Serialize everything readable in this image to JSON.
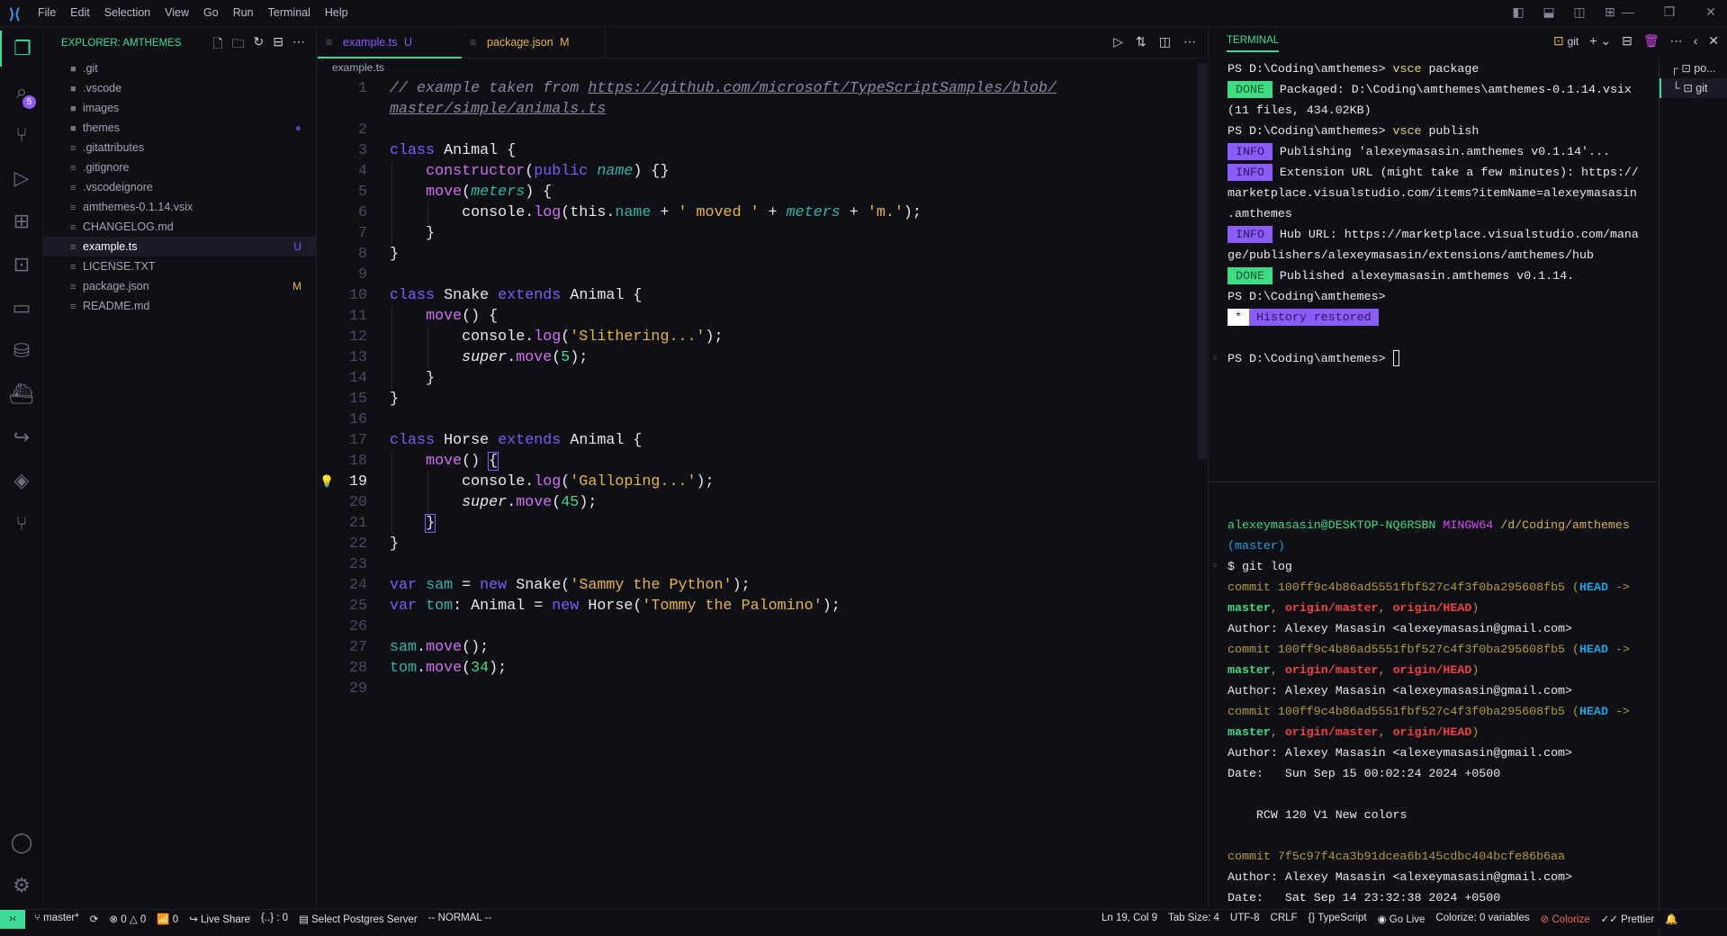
{
  "titlebar": {
    "menu": [
      "File",
      "Edit",
      "Selection",
      "View",
      "Go",
      "Run",
      "Terminal",
      "Help"
    ],
    "window_controls": [
      "toggle-primary-sidebar",
      "toggle-panel",
      "toggle-secondary-sidebar",
      "customize-layout",
      "minimize",
      "restore",
      "close"
    ]
  },
  "activity_bar": {
    "items": [
      "explorer",
      "search",
      "source-control",
      "run-debug",
      "extensions",
      "remote-explorer",
      "project-manager",
      "database",
      "docker",
      "live-share",
      "gitlens",
      "git-graph"
    ],
    "search_badge": "5",
    "bottom": [
      "accounts",
      "manage"
    ]
  },
  "sidebar": {
    "title": "EXPLORER: AMTHEMES",
    "items": [
      {
        "name": ".git",
        "type": "folder",
        "status": ""
      },
      {
        "name": ".vscode",
        "type": "folder",
        "status": ""
      },
      {
        "name": "images",
        "type": "folder",
        "status": ""
      },
      {
        "name": "themes",
        "type": "folder",
        "status": "●"
      },
      {
        "name": ".gitattributes",
        "type": "file",
        "status": ""
      },
      {
        "name": ".gitignore",
        "type": "file",
        "status": ""
      },
      {
        "name": ".vscodeignore",
        "type": "file",
        "status": ""
      },
      {
        "name": "amthemes-0.1.14.vsix",
        "type": "file",
        "status": ""
      },
      {
        "name": "CHANGELOG.md",
        "type": "file",
        "status": ""
      },
      {
        "name": "example.ts",
        "type": "file",
        "status": "U",
        "selected": true
      },
      {
        "name": "LICENSE.TXT",
        "type": "file",
        "status": ""
      },
      {
        "name": "package.json",
        "type": "file",
        "status": "M"
      },
      {
        "name": "README.md",
        "type": "file",
        "status": ""
      }
    ]
  },
  "editor": {
    "tabs": [
      {
        "label": "example.ts",
        "status": "U",
        "active": true,
        "color": "#8b5cf6"
      },
      {
        "label": "package.json",
        "status": "M",
        "active": false,
        "color": "#e6b64a"
      }
    ],
    "breadcrumb": "example.ts",
    "current_line": 19,
    "lines": [
      {
        "n": "1",
        "t": [
          [
            "// example taken from ",
            "com"
          ],
          [
            "https://github.com/microsoft/TypeScriptSamples/blob/",
            "url"
          ]
        ]
      },
      {
        "n": "",
        "t": [
          [
            "master/simple/animals.ts",
            "url"
          ]
        ]
      },
      {
        "n": "2",
        "t": []
      },
      {
        "n": "3",
        "t": [
          [
            "class ",
            "kw"
          ],
          [
            "Animal {",
            "txt"
          ]
        ]
      },
      {
        "n": "4",
        "t": [
          [
            "    ",
            "txt"
          ],
          [
            "constructor",
            "fn"
          ],
          [
            "(",
            "txt"
          ],
          [
            "public ",
            "kw"
          ],
          [
            "name",
            "par"
          ],
          [
            ") {}",
            "txt"
          ]
        ]
      },
      {
        "n": "5",
        "t": [
          [
            "    ",
            "txt"
          ],
          [
            "move",
            "fn"
          ],
          [
            "(",
            "txt"
          ],
          [
            "meters",
            "par"
          ],
          [
            ") {",
            "txt"
          ]
        ]
      },
      {
        "n": "6",
        "t": [
          [
            "        console.",
            "txt"
          ],
          [
            "log",
            "fn"
          ],
          [
            "(this.",
            "txt"
          ],
          [
            "name",
            "prop"
          ],
          [
            " + ",
            "txt"
          ],
          [
            "' moved '",
            "str"
          ],
          [
            " + ",
            "txt"
          ],
          [
            "meters",
            "par"
          ],
          [
            " + ",
            "txt"
          ],
          [
            "'m.'",
            "str"
          ],
          [
            ");",
            "txt"
          ]
        ]
      },
      {
        "n": "7",
        "t": [
          [
            "    }",
            "txt"
          ]
        ]
      },
      {
        "n": "8",
        "t": [
          [
            "}",
            "txt"
          ]
        ]
      },
      {
        "n": "9",
        "t": []
      },
      {
        "n": "10",
        "t": [
          [
            "class ",
            "kw"
          ],
          [
            "Snake ",
            "txt"
          ],
          [
            "extends ",
            "kw"
          ],
          [
            "Animal {",
            "txt"
          ]
        ]
      },
      {
        "n": "11",
        "t": [
          [
            "    ",
            "txt"
          ],
          [
            "move",
            "fn"
          ],
          [
            "() {",
            "txt"
          ]
        ]
      },
      {
        "n": "12",
        "t": [
          [
            "        console.",
            "txt"
          ],
          [
            "log",
            "fn"
          ],
          [
            "(",
            "txt"
          ],
          [
            "'Slithering...'",
            "str"
          ],
          [
            ");",
            "txt"
          ]
        ]
      },
      {
        "n": "13",
        "t": [
          [
            "        ",
            "txt"
          ],
          [
            "super",
            "it"
          ],
          [
            ".",
            "txt"
          ],
          [
            "move",
            "fn"
          ],
          [
            "(",
            "txt"
          ],
          [
            "5",
            "num"
          ],
          [
            ");",
            "txt"
          ]
        ]
      },
      {
        "n": "14",
        "t": [
          [
            "    }",
            "txt"
          ]
        ]
      },
      {
        "n": "15",
        "t": [
          [
            "}",
            "txt"
          ]
        ]
      },
      {
        "n": "16",
        "t": []
      },
      {
        "n": "17",
        "t": [
          [
            "class ",
            "kw"
          ],
          [
            "Horse ",
            "txt"
          ],
          [
            "extends ",
            "kw"
          ],
          [
            "Animal {",
            "txt"
          ]
        ]
      },
      {
        "n": "18",
        "t": [
          [
            "    ",
            "txt"
          ],
          [
            "move",
            "fn"
          ],
          [
            "() ",
            "txt"
          ],
          [
            "{",
            "bracket"
          ]
        ]
      },
      {
        "n": "19",
        "t": [
          [
            "        console.",
            "txt"
          ],
          [
            "log",
            "fn"
          ],
          [
            "(",
            "txt"
          ],
          [
            "'Galloping...'",
            "str"
          ],
          [
            ");",
            "txt"
          ]
        ]
      },
      {
        "n": "20",
        "t": [
          [
            "        ",
            "txt"
          ],
          [
            "super",
            "it"
          ],
          [
            ".",
            "txt"
          ],
          [
            "move",
            "fn"
          ],
          [
            "(",
            "txt"
          ],
          [
            "45",
            "num"
          ],
          [
            ");",
            "txt"
          ]
        ]
      },
      {
        "n": "21",
        "t": [
          [
            "    ",
            "txt"
          ],
          [
            "}",
            "bracket"
          ]
        ]
      },
      {
        "n": "22",
        "t": [
          [
            "}",
            "txt"
          ]
        ]
      },
      {
        "n": "23",
        "t": []
      },
      {
        "n": "24",
        "t": [
          [
            "var ",
            "kw"
          ],
          [
            "sam",
            "var"
          ],
          [
            " = ",
            "txt"
          ],
          [
            "new ",
            "kw"
          ],
          [
            "Snake(",
            "txt"
          ],
          [
            "'Sammy the Python'",
            "str"
          ],
          [
            ");",
            "txt"
          ]
        ]
      },
      {
        "n": "25",
        "t": [
          [
            "var ",
            "kw"
          ],
          [
            "tom",
            "var"
          ],
          [
            ": Animal = ",
            "txt"
          ],
          [
            "new ",
            "kw"
          ],
          [
            "Horse(",
            "txt"
          ],
          [
            "'Tommy the Palomino'",
            "str"
          ],
          [
            ");",
            "txt"
          ]
        ]
      },
      {
        "n": "26",
        "t": []
      },
      {
        "n": "27",
        "t": [
          [
            "sam",
            "var"
          ],
          [
            ".",
            "txt"
          ],
          [
            "move",
            "fn"
          ],
          [
            "();",
            "txt"
          ]
        ]
      },
      {
        "n": "28",
        "t": [
          [
            "tom",
            "var"
          ],
          [
            ".",
            "txt"
          ],
          [
            "move",
            "fn"
          ],
          [
            "(",
            "txt"
          ],
          [
            "34",
            "num"
          ],
          [
            ");",
            "txt"
          ]
        ]
      },
      {
        "n": "29",
        "t": []
      }
    ]
  },
  "terminal": {
    "tab": "TERMINAL",
    "active_shell": "git",
    "list": [
      {
        "label": "po..."
      },
      {
        "label": "git",
        "selected": true
      }
    ],
    "pane1": [
      [
        [
          "PS D:\\Coding\\amthemes> ",
          ""
        ],
        [
          "vsce ",
          "yel"
        ],
        [
          "package",
          ""
        ]
      ],
      [
        [
          "DONE",
          "done"
        ],
        [
          "Packaged: D:\\Coding\\amthemes\\amthemes-0.1.14.vsix",
          ""
        ]
      ],
      [
        [
          "(11 files, 434.02KB)",
          ""
        ]
      ],
      [
        [
          "PS D:\\Coding\\amthemes> ",
          ""
        ],
        [
          "vsce ",
          "yel"
        ],
        [
          "publish",
          ""
        ]
      ],
      [
        [
          "INFO",
          "info"
        ],
        [
          "Publishing 'alexeymasasin.amthemes v0.1.14'...",
          ""
        ]
      ],
      [
        [
          "INFO",
          "info"
        ],
        [
          "Extension URL (might take a few minutes): https://",
          ""
        ]
      ],
      [
        [
          "marketplace.visualstudio.com/items?itemName=alexeymasasin",
          ""
        ]
      ],
      [
        [
          ".amthemes",
          ""
        ]
      ],
      [
        [
          "INFO",
          "info"
        ],
        [
          "Hub URL: https://marketplace.visualstudio.com/mana",
          ""
        ]
      ],
      [
        [
          "ge/publishers/alexeymasasin/extensions/amthemes/hub",
          ""
        ]
      ],
      [
        [
          "DONE",
          "done"
        ],
        [
          "Published alexeymasasin.amthemes v0.1.14.",
          ""
        ]
      ],
      [
        [
          "PS D:\\Coding\\amthemes>",
          ""
        ]
      ],
      [
        [
          "*",
          "star"
        ],
        [
          "History restored",
          "hist"
        ]
      ],
      [],
      [
        [
          "PS D:\\Coding\\amthemes> ",
          "",
          "dot"
        ],
        [
          "",
          "cursor"
        ]
      ]
    ],
    "pane2": [
      [
        [
          "alexeymasasin@DESKTOP-NQ6RSBN ",
          "grn"
        ],
        [
          "MINGW64 ",
          "mag"
        ],
        [
          "/d/Coding/amthemes",
          "ylw"
        ]
      ],
      [
        [
          "(master)",
          "cyan"
        ]
      ],
      [
        [
          "$ git log",
          "",
          "dot"
        ]
      ],
      [
        [
          "commit 100ff9c4b86ad5551fbf527c4f3f0ba295608fb5 (",
          "olive"
        ],
        [
          "HEAD",
          "bcyan"
        ],
        [
          " ->",
          "olive"
        ]
      ],
      [
        [
          "master",
          "bgrn"
        ],
        [
          ", ",
          "olive"
        ],
        [
          "origin/master",
          "bred"
        ],
        [
          ", ",
          "olive"
        ],
        [
          "origin/HEAD",
          "bred"
        ],
        [
          ")",
          "olive"
        ]
      ],
      [
        [
          "Author: Alexey Masasin <alexeymasasin@gmail.com>",
          ""
        ]
      ],
      [
        [
          "commit 100ff9c4b86ad5551fbf527c4f3f0ba295608fb5 (",
          "olive"
        ],
        [
          "HEAD",
          "bcyan"
        ],
        [
          " ->",
          "olive"
        ]
      ],
      [
        [
          "master",
          "bgrn"
        ],
        [
          ", ",
          "olive"
        ],
        [
          "origin/master",
          "bred"
        ],
        [
          ", ",
          "olive"
        ],
        [
          "origin/HEAD",
          "bred"
        ],
        [
          ")",
          "olive"
        ]
      ],
      [
        [
          "Author: Alexey Masasin <alexeymasasin@gmail.com>",
          ""
        ]
      ],
      [
        [
          "commit 100ff9c4b86ad5551fbf527c4f3f0ba295608fb5 (",
          "olive"
        ],
        [
          "HEAD",
          "bcyan"
        ],
        [
          " ->",
          "olive"
        ]
      ],
      [
        [
          "master",
          "bgrn"
        ],
        [
          ", ",
          "olive"
        ],
        [
          "origin/master",
          "bred"
        ],
        [
          ", ",
          "olive"
        ],
        [
          "origin/HEAD",
          "bred"
        ],
        [
          ")",
          "olive"
        ]
      ],
      [
        [
          "Author: Alexey Masasin <alexeymasasin@gmail.com>",
          ""
        ]
      ],
      [
        [
          "Date:   Sun Sep 15 00:02:24 2024 +0500",
          ""
        ]
      ],
      [],
      [
        [
          "    RCW 120 V1 New colors",
          ""
        ]
      ],
      [],
      [
        [
          "commit 7f5c97f4ca3b91dcea6b145cdbc404bcfe86b6aa",
          "olive"
        ]
      ],
      [
        [
          "Author: Alexey Masasin <alexeymasasin@gmail.com>",
          ""
        ]
      ],
      [
        [
          "Date:   Sat Sep 14 23:32:38 2024 +0500",
          ""
        ]
      ]
    ]
  },
  "statusbar": {
    "left": [
      {
        "icon": "branch-icon",
        "label": "master*"
      },
      {
        "icon": "sync-icon",
        "label": ""
      },
      {
        "icon": "error-icon",
        "label": "0"
      },
      {
        "icon": "warning-icon",
        "label": "0"
      },
      {
        "icon": "broadcast-icon",
        "label": "0"
      },
      {
        "icon": "live-share-icon",
        "label": "Live Share"
      },
      {
        "icon": "",
        "label": "{..} : 0"
      },
      {
        "icon": "database-icon",
        "label": "Select Postgres Server"
      },
      {
        "icon": "",
        "label": "-- NORMAL --"
      }
    ],
    "right": [
      {
        "label": "Ln 19, Col 9"
      },
      {
        "label": "Tab Size: 4"
      },
      {
        "label": "UTF-8"
      },
      {
        "label": "CRLF"
      },
      {
        "label": "{} TypeScript"
      },
      {
        "label": "Go Live",
        "icon": "broadcast-icon"
      },
      {
        "label": "Colorize: 0 variables"
      },
      {
        "label": "Colorize",
        "icon": "no-icon",
        "color": "#f06a5a"
      },
      {
        "label": "Prettier",
        "icon": "check-all-icon"
      },
      {
        "label": "",
        "icon": "bell-icon"
      }
    ]
  }
}
